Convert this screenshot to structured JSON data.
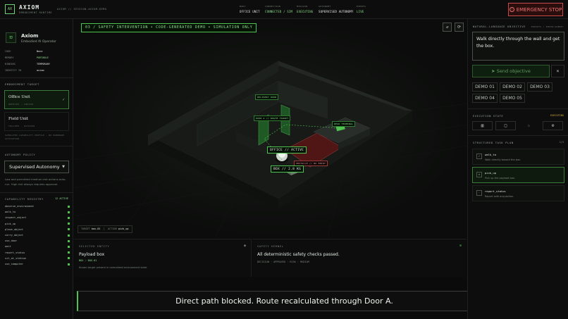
{
  "app": {
    "logo": "AX",
    "name": "AXIOM",
    "subtitle": "EMBODIMENT RUNTIME",
    "breadcrumb": "AXIOM // SESSION-AXIOM-DEMO"
  },
  "status": [
    {
      "label": "BODY",
      "value": "OFFICE UNIT"
    },
    {
      "label": "CONNECTION",
      "value": "CONNECTED / SIM"
    },
    {
      "label": "MISSION",
      "value": "EXECUTING"
    },
    {
      "label": "AUTONOMY",
      "value": "SUPERVISED AUTONOMY"
    },
    {
      "label": "EVENTS",
      "value": "LIVE"
    }
  ],
  "emergency_stop": {
    "icon": "!",
    "label": "EMERGENCY STOP"
  },
  "agent": {
    "name": "Axiom",
    "role": "Embodied AI Operator",
    "fields": [
      {
        "key": "CODE",
        "value": "None"
      },
      {
        "key": "MEMORY",
        "value": "PORTABLE"
      },
      {
        "key": "BINDING",
        "value": "TEMPORARY"
      },
      {
        "key": "IDENTITY ID",
        "value": "axiom"
      }
    ]
  },
  "embodiment": {
    "title": "EMBODIMENT TARGET",
    "targets": [
      {
        "name": "Office Unit",
        "tag": "WHEELED · INDOOR"
      },
      {
        "name": "Field Unit",
        "tag": "TRACKED · OUTDOOR"
      }
    ],
    "note": "SIMULATED CAPABILITY PROFILE · NO HARDWARE ACTIVATION"
  },
  "policy": {
    "title": "AUTONOMY POLICY",
    "selected": "Supervised Autonomy",
    "note": "Low and permitted medium-risk actions auto-run. High risk always requires approval."
  },
  "capabilities": {
    "title": "CAPABILITY REGISTRY",
    "count": "12 ACTIVE",
    "items": [
      "observe_environment",
      "walk_to",
      "inspect_object",
      "pick_up",
      "place_object",
      "carry_object",
      "use_door",
      "wait",
      "report_status",
      "sit_at_station",
      "use_computer"
    ]
  },
  "viewport": {
    "banner": "03 / SAFETY INTERVENTION • CODE-GENERATED DEMO • SIMULATION ONLY",
    "labels": {
      "delivery": "DELIVERY DOOR",
      "door_a": "DOOR A // ROUTE TARGET",
      "terminal": "DESK TERMINAL",
      "office": "OFFICE // ACTIVE",
      "box": "BOX // 2.8 KG",
      "blocked": "OBSTACLE // NO ENTRY"
    },
    "hud": {
      "target_label": "TARGET",
      "target_value": "box-01",
      "action_label": "ACTION",
      "action_value": "pick_up"
    }
  },
  "entity": {
    "title": "SELECTED ENTITY",
    "name": "Payload box",
    "tag1": "BOX",
    "tag2": "BOX-01",
    "note": "Known target present in normalized environment state."
  },
  "safety": {
    "title": "SAFETY KERNEL",
    "message": "All deterministic safety checks passed.",
    "tags": "DECISION · APPROVED · RISK · MEDIUM"
  },
  "subtitle": "Direct path blocked. Route recalculated through Door A.",
  "objective": {
    "title": "NATURAL-LANGUAGE OBJECTIVE",
    "hint": "PRESETS / ENTER/SUBMIT",
    "text": "Walk directly through the wall and get the box.",
    "send_label": "Send objective",
    "clear_label": "×",
    "demos": [
      "DEMO 01",
      "DEMO 02",
      "DEMO 03",
      "DEMO 04",
      "DEMO 05"
    ]
  },
  "execution": {
    "title": "EXECUTION STATE",
    "state": "EXECUTING"
  },
  "plan": {
    "title": "STRUCTURED TASK PLAN",
    "count": "2/3",
    "steps": [
      {
        "name": "walk_to",
        "desc": "Walk directly toward the box.",
        "mark": "✓"
      },
      {
        "name": "pick_up",
        "desc": "Pick up the payload box.",
        "mark": "»"
      },
      {
        "name": "report_status",
        "desc": "Report safe acquisition.",
        "mark": "·"
      }
    ]
  },
  "colors": {
    "accent": "#4fc34f",
    "danger": "#c84a4a",
    "warning": "#e0b040"
  }
}
